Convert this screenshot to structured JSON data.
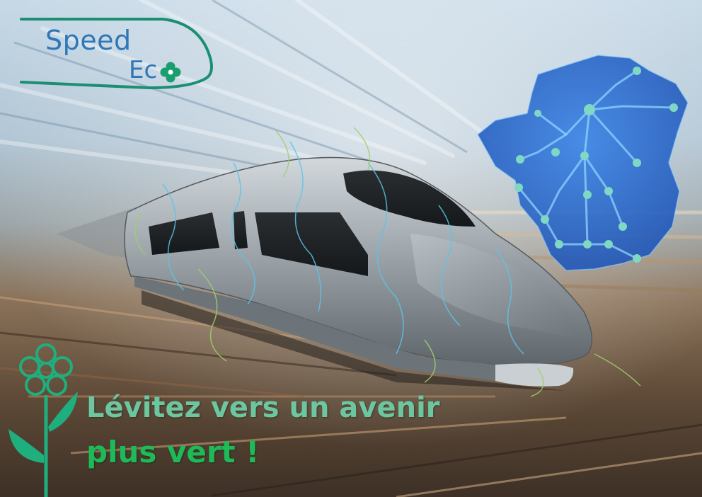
{
  "logo": {
    "line1": "Speed",
    "line2": "Ec",
    "line2_icon": "clover-icon",
    "color": "#2f77b6",
    "swoosh_color": "#1b8e73"
  },
  "slogan": {
    "line1": "Lévitez vers un avenir",
    "line2": "plus vert !",
    "line1_color": "#6cc7a0",
    "line2_color": "#1dbb57",
    "icon": "flower-icon"
  },
  "map": {
    "icon": "france-map-icon",
    "color": "#2d6fd4",
    "network_color": "#8fd3ff"
  },
  "train": {
    "icon": "high-speed-train-icon",
    "body_color": "#9aa2a8"
  }
}
